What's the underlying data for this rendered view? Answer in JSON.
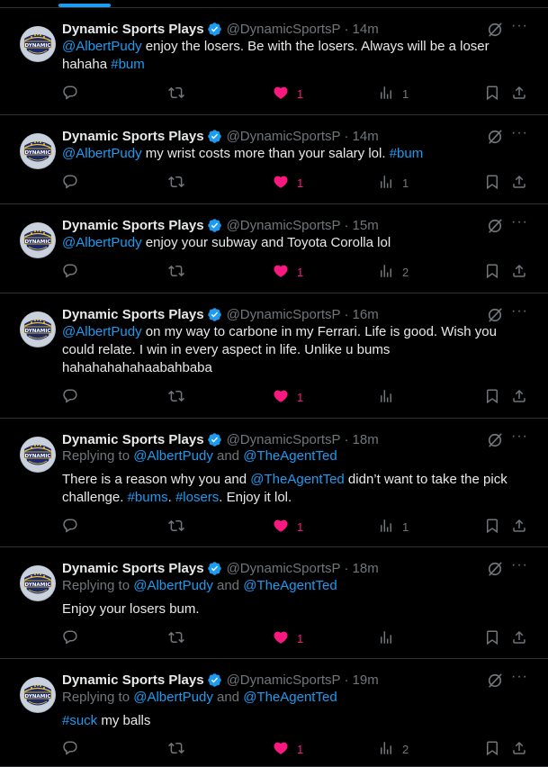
{
  "colors": {
    "background": "#000000",
    "text": "#e7e9ea",
    "muted": "#71767b",
    "link": "#1d9bf0",
    "like": "#f91880",
    "divider": "#2f3336"
  },
  "icons": {
    "reply": "reply-icon",
    "retweet": "retweet-icon",
    "like": "heart-filled-icon",
    "views": "views-icon",
    "bookmark": "bookmark-icon",
    "share": "share-icon",
    "grok": "grok-icon",
    "more": "more-icon",
    "verified": "verified-badge-icon"
  },
  "tweets": [
    {
      "name": "Dynamic Sports Plays",
      "handle": "@DynamicSportsP",
      "time": "14m",
      "segments": [
        {
          "t": "@AlbertPudy",
          "link": true
        },
        {
          "t": " enjoy the losers. Be with the losers. Always will be a loser hahaha "
        },
        {
          "t": "#bum",
          "link": true
        }
      ],
      "likes": "1",
      "views": "1"
    },
    {
      "name": "Dynamic Sports Plays",
      "handle": "@DynamicSportsP",
      "time": "14m",
      "segments": [
        {
          "t": "@AlbertPudy",
          "link": true
        },
        {
          "t": " my wrist costs more than your salary lol. "
        },
        {
          "t": "#bum",
          "link": true
        }
      ],
      "likes": "1",
      "views": "1"
    },
    {
      "name": "Dynamic Sports Plays",
      "handle": "@DynamicSportsP",
      "time": "15m",
      "segments": [
        {
          "t": "@AlbertPudy",
          "link": true
        },
        {
          "t": " enjoy your subway and Toyota Corolla lol"
        }
      ],
      "likes": "1",
      "views": "2"
    },
    {
      "name": "Dynamic Sports Plays",
      "handle": "@DynamicSportsP",
      "time": "16m",
      "segments": [
        {
          "t": "@AlbertPudy",
          "link": true
        },
        {
          "t": " on my way to carbone in my Ferrari. Life is good. Wish you could relate. I win in every aspect in life. Unlike u bums hahahahahahaabahbaba"
        }
      ],
      "likes": "1",
      "views": ""
    },
    {
      "name": "Dynamic Sports Plays",
      "handle": "@DynamicSportsP",
      "time": "18m",
      "replying": {
        "prefix": "Replying to ",
        "a": "@AlbertPudy",
        "and": " and ",
        "b": "@TheAgentTed"
      },
      "segments": [
        {
          "t": "There is a reason why you and "
        },
        {
          "t": "@TheAgentTed",
          "link": true
        },
        {
          "t": " didn’t want to take the pick challenge. "
        },
        {
          "t": "#bums",
          "link": true
        },
        {
          "t": ". "
        },
        {
          "t": "#losers",
          "link": true
        },
        {
          "t": ". Enjoy it lol."
        }
      ],
      "likes": "1",
      "views": "1"
    },
    {
      "name": "Dynamic Sports Plays",
      "handle": "@DynamicSportsP",
      "time": "18m",
      "replying": {
        "prefix": "Replying to ",
        "a": "@AlbertPudy",
        "and": " and ",
        "b": "@TheAgentTed"
      },
      "segments": [
        {
          "t": "Enjoy your losers bum."
        }
      ],
      "likes": "1",
      "views": ""
    },
    {
      "name": "Dynamic Sports Plays",
      "handle": "@DynamicSportsP",
      "time": "19m",
      "replying": {
        "prefix": "Replying to ",
        "a": "@AlbertPudy",
        "and": " and ",
        "b": "@TheAgentTed"
      },
      "segments": [
        {
          "t": "#suck",
          "link": true
        },
        {
          "t": " my balls"
        }
      ],
      "likes": "1",
      "views": "2"
    }
  ]
}
